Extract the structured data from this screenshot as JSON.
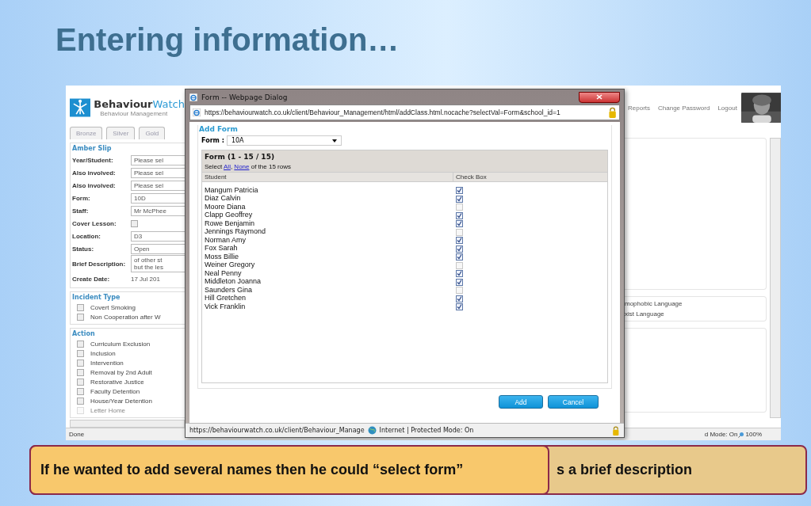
{
  "slide": {
    "title": "Entering information…"
  },
  "app": {
    "logo": {
      "name": "**Behaviour**Watch",
      "tagline": "Behaviour Management"
    },
    "tabs": [
      {
        "label": "Bronze",
        "selected": false
      },
      {
        "label": "Silver",
        "selected": false
      },
      {
        "label": "Gold",
        "selected": false
      }
    ],
    "amber_slip": {
      "legend": "Amber Slip",
      "fields": [
        {
          "label": "Year/Student:",
          "kind": "select",
          "value": "Please sel"
        },
        {
          "label": "Also involved:",
          "kind": "select",
          "value": "Please sel"
        },
        {
          "label": "Also involved:",
          "kind": "select",
          "value": "Please sel"
        },
        {
          "label": "Form:",
          "kind": "text",
          "value": "10D"
        },
        {
          "label": "Staff:",
          "kind": "text",
          "value": "Mr McPhee"
        },
        {
          "label": "Cover Lesson:",
          "kind": "checkbox",
          "checked": false
        },
        {
          "label": "Location:",
          "kind": "text",
          "value": "D3"
        },
        {
          "label": "Status:",
          "kind": "text",
          "value": "Open"
        },
        {
          "label": "Brief Description:",
          "kind": "textarea",
          "lines": [
            "of other st",
            "but the les"
          ]
        },
        {
          "label": "Create Date:",
          "kind": "plain",
          "value": "17 Jul 201"
        }
      ]
    },
    "incident_type": {
      "legend": "Incident Type",
      "items": [
        {
          "label": "Covert Smoking",
          "checked": false
        },
        {
          "label": "Non Cooperation after W",
          "checked": false
        }
      ]
    },
    "action": {
      "legend": "Action",
      "items": [
        {
          "label": "Curriculum Exclusion",
          "checked": false,
          "disabled": false
        },
        {
          "label": "Inclusion",
          "checked": false,
          "disabled": false
        },
        {
          "label": "Intervention",
          "checked": false,
          "disabled": false
        },
        {
          "label": "Removal by 2nd Adult",
          "checked": false,
          "disabled": false
        },
        {
          "label": "Restorative Justice",
          "checked": false,
          "disabled": false
        },
        {
          "label": "Faculty Detention",
          "checked": false,
          "disabled": false
        },
        {
          "label": "House/Year Detention",
          "checked": false,
          "disabled": false
        },
        {
          "label": "Letter Home",
          "checked": false,
          "disabled": true
        }
      ]
    },
    "nav": [
      "Reports",
      "Change Password",
      "Logout"
    ],
    "right_incident_items": [
      "mophobic Language",
      "xist Language"
    ],
    "status_bar": {
      "left": "Done",
      "mode": "d Mode: On",
      "zoom": "100%"
    }
  },
  "dialog": {
    "title": "Form -- Webpage Dialog",
    "url": "https://behaviourwatch.co.uk/client/Behaviour_Management/html/addClass.html.nocache?selectVal=Form&school_id=1",
    "legend": "Add Form",
    "form_label": "Form :",
    "form_value": "10A",
    "grid_title": "Form (1 - 15 / 15)",
    "select_line": {
      "before": "Select ",
      "all": "All",
      "sep": ", ",
      "none": "None",
      "after": " of the 15 rows"
    },
    "columns": [
      "Student",
      "Check Box"
    ],
    "rows": [
      {
        "name": "Mangum Patricia",
        "checked": true
      },
      {
        "name": "Diaz Calvin",
        "checked": true
      },
      {
        "name": "Moore Diana",
        "checked": false
      },
      {
        "name": "Clapp Geoffrey",
        "checked": true
      },
      {
        "name": "Rowe Benjamin",
        "checked": true
      },
      {
        "name": "Jennings Raymond",
        "checked": false
      },
      {
        "name": "Norman Amy",
        "checked": true
      },
      {
        "name": "Fox Sarah",
        "checked": true
      },
      {
        "name": "Moss Billie",
        "checked": true
      },
      {
        "name": "Weiner Gregory",
        "checked": false
      },
      {
        "name": "Neal Penny",
        "checked": true
      },
      {
        "name": "Middleton Joanna",
        "checked": true
      },
      {
        "name": "Saunders Gina",
        "checked": false
      },
      {
        "name": "Hill Gretchen",
        "checked": true
      },
      {
        "name": "Vick Franklin",
        "checked": true
      }
    ],
    "buttons": [
      "Add",
      "Cancel"
    ],
    "status_url": "https://behaviourwatch.co.uk/client/Behaviour_Manage",
    "status_zone": "Internet | Protected Mode: On"
  },
  "caption": {
    "back": "s a brief description",
    "front": "If he wanted to add several names then he could “select form”"
  }
}
